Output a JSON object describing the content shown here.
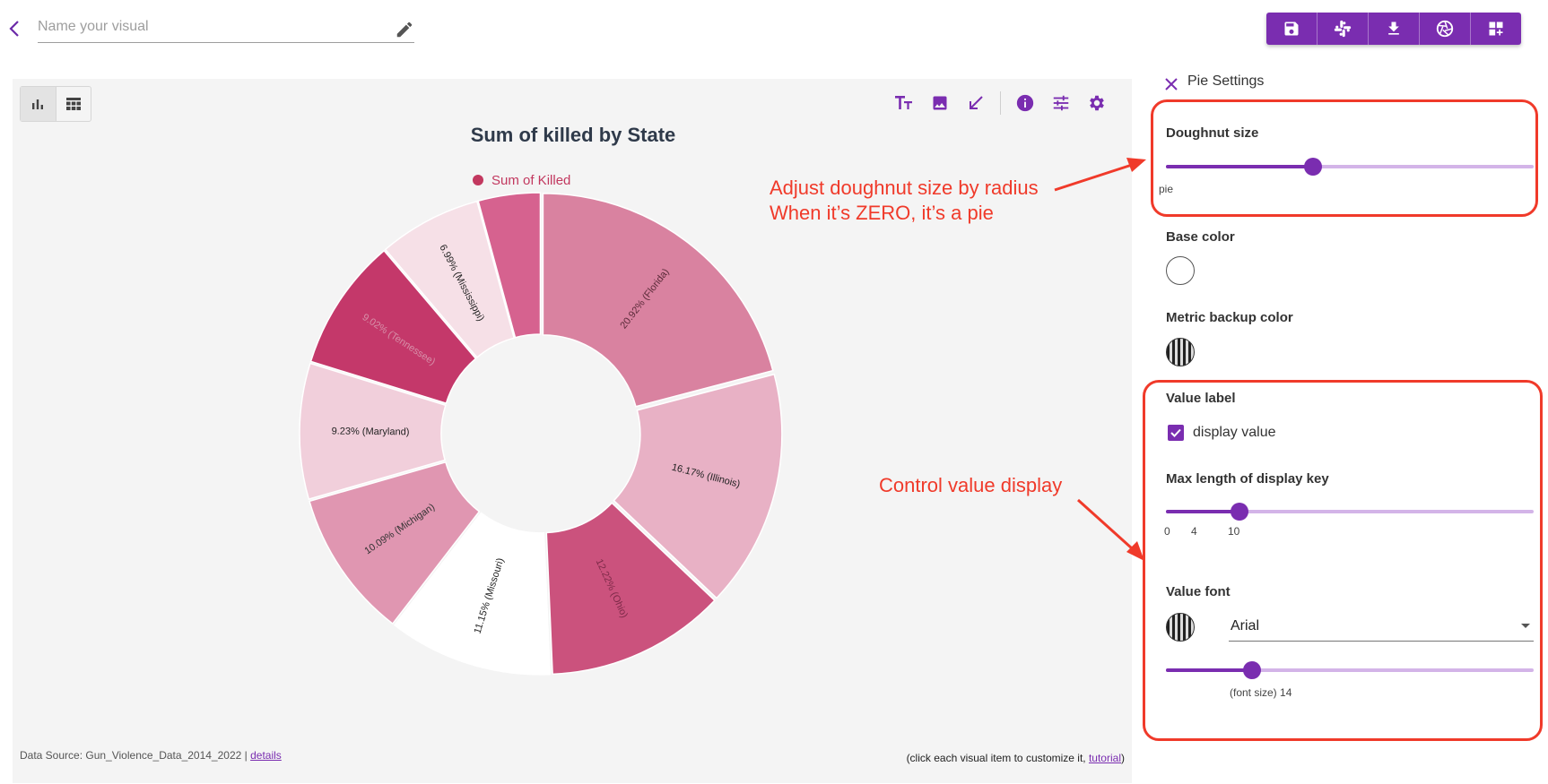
{
  "header": {
    "name_placeholder": "Name your visual"
  },
  "toolbar": {
    "buttons": [
      "save-icon",
      "slack-icon",
      "download-icon",
      "aperture-icon",
      "add-dashboard-icon"
    ]
  },
  "panel": {
    "footer_source_prefix": "Data Source: Gun_Violence_Data_2014_2022 |",
    "footer_source_link": "details",
    "footer_hint_prefix": "(click each visual item to customize it,",
    "footer_hint_link": "tutorial",
    "footer_hint_suffix": ")"
  },
  "chart_data": {
    "type": "pie",
    "title": "Sum of killed by State",
    "legend": [
      "Sum of Killed"
    ],
    "legend_color": "#c2385f",
    "doughnut": true,
    "slices": [
      {
        "label": "20.92% (Florida)",
        "value": 20.92,
        "color": "#d982a0",
        "text_color": "#5a2a38"
      },
      {
        "label": "16.17% (Illinois)",
        "value": 16.17,
        "color": "#e8b1c5",
        "text_color": "#222222"
      },
      {
        "label": "12.22% (Ohio)",
        "value": 12.22,
        "color": "#cb527d",
        "text_color": "#7d2a48"
      },
      {
        "label": "11.15% (Missouri)",
        "value": 11.15,
        "color": "#ffffff",
        "text_color": "#222222"
      },
      {
        "label": "10.09% (Michigan)",
        "value": 10.09,
        "color": "#e096b1",
        "text_color": "#333333"
      },
      {
        "label": "9.23% (Maryland)",
        "value": 9.23,
        "color": "#f1cfdb",
        "text_color": "#222222"
      },
      {
        "label": "9.02% (Tennessee)",
        "value": 9.02,
        "color": "#c4386a",
        "text_color": "#d78fa8"
      },
      {
        "label": "6.99% (Mississippi)",
        "value": 6.99,
        "color": "#f6e0e7",
        "text_color": "#222222"
      },
      {
        "label": "",
        "value": 4.21,
        "color": "#d6628f",
        "text_color": "#222222"
      }
    ]
  },
  "annotations": {
    "doughnut_note_line1": "Adjust doughnut size by radius",
    "doughnut_note_line2": "When it’s ZERO, it’s a pie",
    "value_note": "Control value display",
    "color": "#f03a2a"
  },
  "settings": {
    "title": "Pie Settings",
    "doughnut_size": {
      "label": "Doughnut size",
      "min_label": "pie",
      "value": 0.4
    },
    "base_color": {
      "label": "Base color"
    },
    "metric_backup_color": {
      "label": "Metric backup color"
    },
    "value_label": {
      "label": "Value label",
      "checkbox_label": "display value",
      "checked": true
    },
    "max_length": {
      "label": "Max length of display key",
      "ticks": [
        "0",
        "4",
        "10"
      ],
      "value": 10
    },
    "value_font": {
      "label": "Value font",
      "font_name": "Arial",
      "font_size_label": "(font size) 14",
      "font_size": 14
    }
  }
}
